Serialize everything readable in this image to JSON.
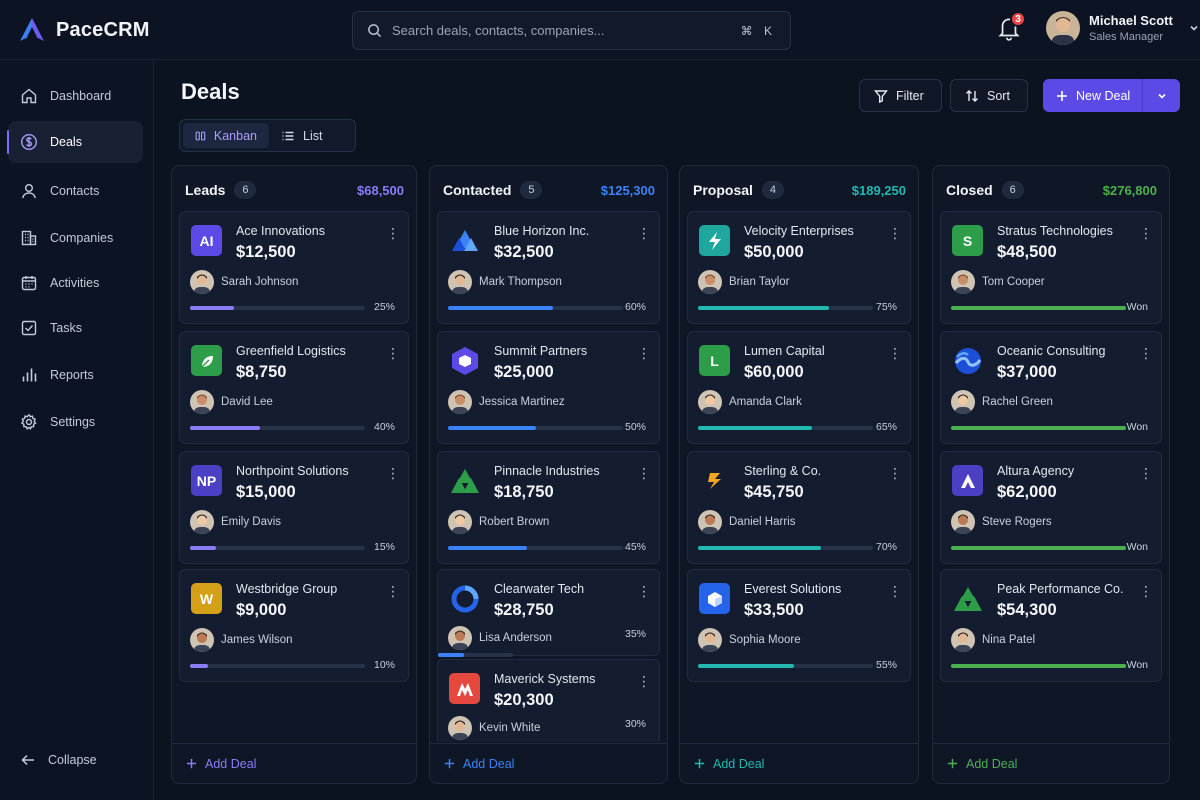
{
  "app": {
    "name": "PaceCRM"
  },
  "search": {
    "placeholder": "Search deals, contacts, companies...",
    "shortcut": "⌘ K"
  },
  "notifications": {
    "count": "3"
  },
  "user": {
    "name": "Michael Scott",
    "role": "Sales Manager"
  },
  "sidebar": {
    "items": [
      {
        "label": "Dashboard",
        "icon": "home-icon"
      },
      {
        "label": "Deals",
        "icon": "dollar-circle-icon",
        "active": true
      },
      {
        "label": "Contacts",
        "icon": "person-icon"
      },
      {
        "label": "Companies",
        "icon": "building-icon"
      },
      {
        "label": "Activities",
        "icon": "calendar-icon"
      },
      {
        "label": "Tasks",
        "icon": "checkbox-icon"
      },
      {
        "label": "Reports",
        "icon": "bar-chart-icon"
      },
      {
        "label": "Settings",
        "icon": "gear-icon"
      }
    ],
    "collapse_label": "Collapse"
  },
  "page": {
    "title": "Deals",
    "views": [
      {
        "label": "Kanban",
        "active": true
      },
      {
        "label": "List"
      }
    ],
    "filter_label": "Filter",
    "sort_label": "Sort",
    "new_deal_label": "New Deal"
  },
  "colors": {
    "accent": "#5b4ae6",
    "leads": "#8b7cf6",
    "contacted": "#3b82f6",
    "proposal": "#22b8b0",
    "closed": "#4caf50"
  },
  "columns": [
    {
      "title": "Leads",
      "count": "6",
      "total": "$68,500",
      "color": "#8b7cf6",
      "add_label": "Add Deal",
      "cards": [
        {
          "company": "Ace Innovations",
          "amount": "$12,500",
          "person": "Sarah Johnson",
          "progress_label": "25%",
          "progress": 0.25,
          "logo_text": "AI",
          "logo_color": "#5b4ae6"
        },
        {
          "company": "Greenfield Logistics",
          "amount": "$8,750",
          "person": "David Lee",
          "progress_label": "40%",
          "progress": 0.4,
          "logo_text": "",
          "logo_icon": "leaf-icon",
          "logo_color": "#2e9d4a"
        },
        {
          "company": "Northpoint Solutions",
          "amount": "$15,000",
          "person": "Emily Davis",
          "progress_label": "15%",
          "progress": 0.15,
          "logo_text": "NP",
          "logo_color": "#4b3fc4"
        },
        {
          "company": "Westbridge Group",
          "amount": "$9,000",
          "person": "James Wilson",
          "progress_label": "10%",
          "progress": 0.1,
          "logo_text": "W",
          "logo_color": "#d4a017"
        }
      ]
    },
    {
      "title": "Contacted",
      "count": "5",
      "total": "$125,300",
      "color": "#3b82f6",
      "add_label": "Add Deal",
      "cards": [
        {
          "company": "Blue Horizon Inc.",
          "amount": "$32,500",
          "person": "Mark Thompson",
          "progress_label": "60%",
          "progress": 0.6,
          "logo_icon": "mountains-icon",
          "logo_color": "transparent"
        },
        {
          "company": "Summit Partners",
          "amount": "$25,000",
          "person": "Jessica Martinez",
          "progress_label": "50%",
          "progress": 0.5,
          "logo_icon": "hexagon-icon",
          "logo_color": "transparent"
        },
        {
          "company": "Pinnacle Industries",
          "amount": "$18,750",
          "person": "Robert Brown",
          "progress_label": "45%",
          "progress": 0.45,
          "logo_icon": "peaks-icon",
          "logo_color": "transparent"
        },
        {
          "company": "Clearwater Tech",
          "amount": "$28,750",
          "person": "Lisa Anderson",
          "progress_label": "35%",
          "progress": 0.35,
          "logo_icon": "ring-icon",
          "logo_color": "transparent"
        },
        {
          "company": "Maverick Systems",
          "amount": "$20,300",
          "person": "Kevin White",
          "progress_label": "30%",
          "progress": 0.3,
          "logo_icon": "m-icon",
          "logo_color": "#e5483f"
        }
      ]
    },
    {
      "title": "Proposal",
      "count": "4",
      "total": "$189,250",
      "color": "#22b8b0",
      "add_label": "Add Deal",
      "cards": [
        {
          "company": "Velocity Enterprises",
          "amount": "$50,000",
          "person": "Brian Taylor",
          "progress_label": "75%",
          "progress": 0.75,
          "logo_icon": "bolt-icon",
          "logo_color": "#1fa79e"
        },
        {
          "company": "Lumen Capital",
          "amount": "$60,000",
          "person": "Amanda Clark",
          "progress_label": "65%",
          "progress": 0.65,
          "logo_text": "L",
          "logo_color": "#2e9d4a"
        },
        {
          "company": "Sterling & Co.",
          "amount": "$45,750",
          "person": "Daniel Harris",
          "progress_label": "70%",
          "progress": 0.7,
          "logo_icon": "sterling-icon",
          "logo_color": "transparent"
        },
        {
          "company": "Everest Solutions",
          "amount": "$33,500",
          "person": "Sophia Moore",
          "progress_label": "55%",
          "progress": 0.55,
          "logo_icon": "cube-icon",
          "logo_color": "#2563eb"
        }
      ]
    },
    {
      "title": "Closed",
      "count": "6",
      "total": "$276,800",
      "color": "#4caf50",
      "add_label": "Add Deal",
      "cards": [
        {
          "company": "Stratus Technologies",
          "amount": "$48,500",
          "person": "Tom Cooper",
          "progress_label": "Won",
          "progress": 1,
          "logo_text": "S",
          "logo_color": "#2e9d4a"
        },
        {
          "company": "Oceanic Consulting",
          "amount": "$37,000",
          "person": "Rachel Green",
          "progress_label": "Won",
          "progress": 1,
          "logo_icon": "wave-icon",
          "logo_color": "transparent"
        },
        {
          "company": "Altura Agency",
          "amount": "$62,000",
          "person": "Steve Rogers",
          "progress_label": "Won",
          "progress": 1,
          "logo_icon": "a-icon",
          "logo_color": "#4b3fc4"
        },
        {
          "company": "Peak Performance Co.",
          "amount": "$54,300",
          "person": "Nina Patel",
          "progress_label": "Won",
          "progress": 1,
          "logo_icon": "peaks-icon",
          "logo_color": "transparent"
        }
      ]
    }
  ]
}
